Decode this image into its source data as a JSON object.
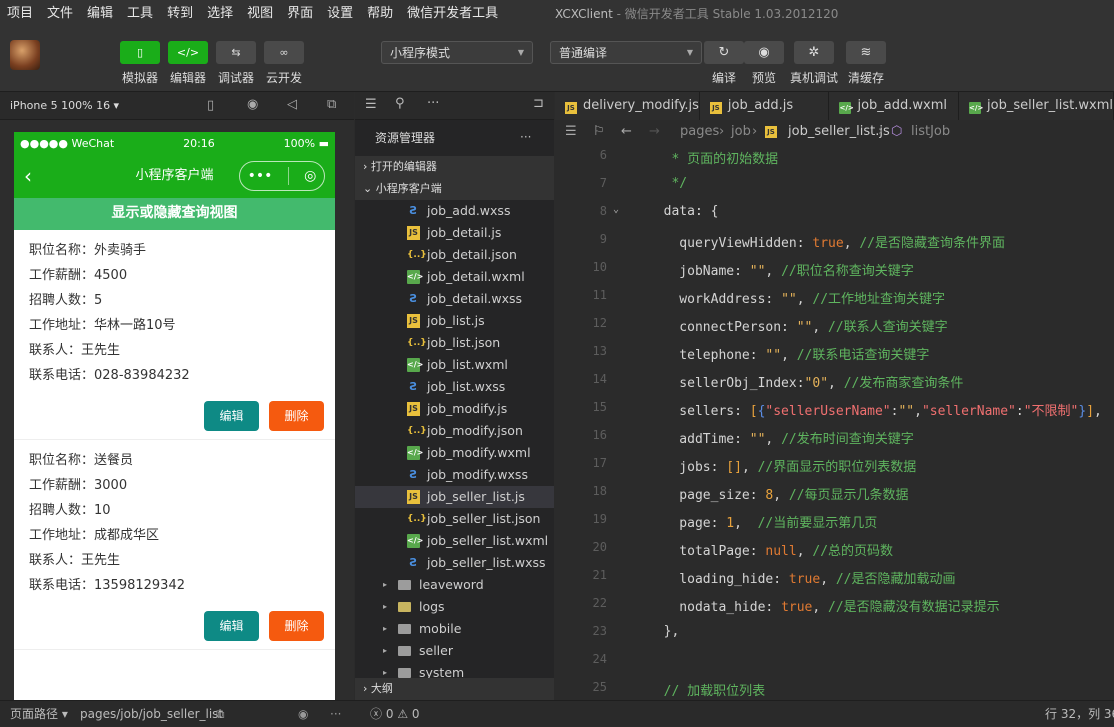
{
  "menu": [
    "项目",
    "文件",
    "编辑",
    "工具",
    "转到",
    "选择",
    "视图",
    "界面",
    "设置",
    "帮助",
    "微信开发者工具"
  ],
  "window_title": {
    "main": "XCXClient",
    "sub": " - 微信开发者工具 Stable 1.03.2012120"
  },
  "toolbar": {
    "left_buttons": [
      {
        "label": "模拟器",
        "icon": "phone-icon",
        "glyph": "▯",
        "style": "green"
      },
      {
        "label": "编辑器",
        "icon": "code-icon",
        "glyph": "</>",
        "style": "green"
      },
      {
        "label": "调试器",
        "icon": "debug-switch-icon",
        "glyph": "⇆",
        "style": "gray"
      },
      {
        "label": "云开发",
        "icon": "cloud-link-icon",
        "glyph": "∞",
        "style": "gray"
      }
    ],
    "mode_select": "小程序模式",
    "compile_select": "普通编译",
    "right_buttons": [
      {
        "label": "编译",
        "icon": "refresh-icon",
        "glyph": "↻"
      },
      {
        "label": "预览",
        "icon": "eye-icon",
        "glyph": "◉"
      },
      {
        "label": "真机调试",
        "icon": "bug-icon",
        "glyph": "✲"
      },
      {
        "label": "清缓存",
        "icon": "layers-icon",
        "glyph": "≋"
      }
    ]
  },
  "simulator": {
    "device": "iPhone 5 100% 16 ▾",
    "status_left": "●●●●● WeChat",
    "status_time": "20:16",
    "status_battery": "100%",
    "nav_title": "小程序客户端",
    "toggle_label": "显示或隐藏查询视图",
    "edit_label": "编辑",
    "delete_label": "删除",
    "jobs": [
      {
        "title": "职位名称：外卖骑手",
        "salary": "工作薪酬：4500",
        "count": "招聘人数：5",
        "address": "工作地址：华林一路10号",
        "contact": "联系人：王先生",
        "phone": "联系电话：028-83984232"
      },
      {
        "title": "职位名称：送餐员",
        "salary": "工作薪酬：3000",
        "count": "招聘人数：10",
        "address": "工作地址：成都成华区",
        "contact": "联系人：王先生",
        "phone": "联系电话：13598129342"
      }
    ]
  },
  "explorer": {
    "title": "资源管理器",
    "open_editors": "打开的编辑器",
    "project": "小程序客户端",
    "outline": "大纲",
    "files": [
      {
        "name": "job_add.wxss",
        "type": "wxss"
      },
      {
        "name": "job_detail.js",
        "type": "js"
      },
      {
        "name": "job_detail.json",
        "type": "json"
      },
      {
        "name": "job_detail.wxml",
        "type": "wxml"
      },
      {
        "name": "job_detail.wxss",
        "type": "wxss"
      },
      {
        "name": "job_list.js",
        "type": "js"
      },
      {
        "name": "job_list.json",
        "type": "json"
      },
      {
        "name": "job_list.wxml",
        "type": "wxml"
      },
      {
        "name": "job_list.wxss",
        "type": "wxss"
      },
      {
        "name": "job_modify.js",
        "type": "js"
      },
      {
        "name": "job_modify.json",
        "type": "json"
      },
      {
        "name": "job_modify.wxml",
        "type": "wxml"
      },
      {
        "name": "job_modify.wxss",
        "type": "wxss"
      },
      {
        "name": "job_seller_list.js",
        "type": "js",
        "active": true
      },
      {
        "name": "job_seller_list.json",
        "type": "json"
      },
      {
        "name": "job_seller_list.wxml",
        "type": "wxml"
      },
      {
        "name": "job_seller_list.wxss",
        "type": "wxss"
      }
    ],
    "folders": [
      "leaveword",
      "logs",
      "mobile",
      "seller",
      "system"
    ]
  },
  "tabs": [
    {
      "name": "delivery_modify.js",
      "type": "js"
    },
    {
      "name": "job_add.js",
      "type": "js"
    },
    {
      "name": "job_add.wxml",
      "type": "wxml"
    },
    {
      "name": "job_seller_list.wxml",
      "type": "wxml"
    }
  ],
  "breadcrumb": {
    "parts": [
      "pages",
      "job",
      "job_seller_list.js",
      "listJob"
    ]
  },
  "code_lines": [
    {
      "n": "6",
      "html": "<span class='c-cm'>   * 页面的初始数据</span>"
    },
    {
      "n": "7",
      "html": "<span class='c-cm'>   */</span>"
    },
    {
      "n": "8",
      "html": "  data: {"
    },
    {
      "n": "9",
      "html": "    queryViewHidden: <span class='c-kw'>true</span>, <span class='c-cm'>//是否隐藏查询条件界面</span>"
    },
    {
      "n": "10",
      "html": "    jobName: <span class='c-str'>\"\"</span>, <span class='c-cm'>//职位名称查询关键字</span>"
    },
    {
      "n": "11",
      "html": "    workAddress: <span class='c-str'>\"\"</span>, <span class='c-cm'>//工作地址查询关键字</span>"
    },
    {
      "n": "12",
      "html": "    connectPerson: <span class='c-str'>\"\"</span>, <span class='c-cm'>//联系人查询关键字</span>"
    },
    {
      "n": "13",
      "html": "    telephone: <span class='c-str'>\"\"</span>, <span class='c-cm'>//联系电话查询关键字</span>"
    },
    {
      "n": "14",
      "html": "    sellerObj_Index:<span class='c-str'>\"0\"</span>, <span class='c-cm'>//发布商家查询条件</span>"
    },
    {
      "n": "15",
      "html": "    sellers: <span class='c-num'>[</span><span class='c-br'>{</span><span class='c-red'>\"sellerUserName\"</span>:<span class='c-str'>\"\"</span>,<span class='c-red'>\"sellerName\"</span>:<span class='c-red'>\"不限制\"</span><span class='c-br'>}</span><span class='c-num'>]</span>,"
    },
    {
      "n": "16",
      "html": "    addTime: <span class='c-str'>\"\"</span>, <span class='c-cm'>//发布时间查询关键字</span>"
    },
    {
      "n": "17",
      "html": "    jobs: <span class='c-num'>[]</span>, <span class='c-cm'>//界面显示的职位列表数据</span>"
    },
    {
      "n": "18",
      "html": "    page_size: <span class='c-num'>8</span>, <span class='c-cm'>//每页显示几条数据</span>"
    },
    {
      "n": "19",
      "html": "    page: <span class='c-num'>1</span>,  <span class='c-cm'>//当前要显示第几页</span>"
    },
    {
      "n": "20",
      "html": "    totalPage: <span class='c-kw'>null</span>, <span class='c-cm'>//总的页码数</span>"
    },
    {
      "n": "21",
      "html": "    loading_hide: <span class='c-kw'>true</span>, <span class='c-cm'>//是否隐藏加载动画</span>"
    },
    {
      "n": "22",
      "html": "    nodata_hide: <span class='c-kw'>true</span>, <span class='c-cm'>//是否隐藏没有数据记录提示</span>"
    },
    {
      "n": "23",
      "html": "  },"
    },
    {
      "n": "24",
      "html": ""
    },
    {
      "n": "25",
      "html": "<span class='c-cm'>  // 加载职位列表</span>"
    }
  ],
  "statusbar": {
    "page_path_label": "页面路径 ▾",
    "page_path": "pages/job/job_seller_list",
    "errors": "0",
    "warnings": "0",
    "position": "行 32，列 36"
  },
  "colors": {
    "wechat_green": "#1aad19",
    "edit_btn": "#0e8a85",
    "delete_btn": "#f55a0f"
  }
}
